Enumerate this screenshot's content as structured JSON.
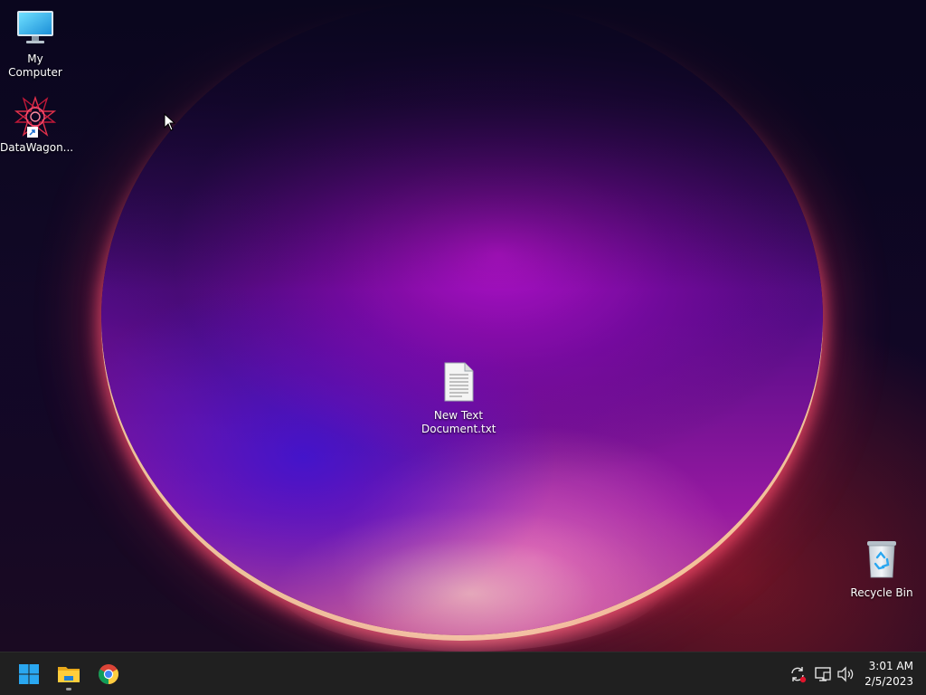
{
  "desktop": {
    "icons": [
      {
        "label": "My Computer",
        "icon": "monitor-icon"
      },
      {
        "label": "DataWagon...",
        "icon": "datawagon-app-icon"
      },
      {
        "label": "New Text Document.txt",
        "label_line1": "New Text",
        "label_line2": "Document.txt",
        "icon": "text-file-icon"
      },
      {
        "label": "Recycle Bin",
        "icon": "recycle-bin-icon"
      }
    ]
  },
  "taskbar": {
    "pinned": [
      {
        "name": "Start",
        "icon": "windows-start-icon"
      },
      {
        "name": "File Explorer",
        "icon": "folder-icon"
      },
      {
        "name": "Google Chrome",
        "icon": "chrome-icon"
      }
    ],
    "tray": [
      "sync-icon",
      "network-icon",
      "volume-icon"
    ],
    "clock": {
      "time": "3:01 AM",
      "date": "2/5/2023"
    }
  },
  "colors": {
    "taskbar_bg": "#202020",
    "accent_blue": "#2aa7f0"
  }
}
